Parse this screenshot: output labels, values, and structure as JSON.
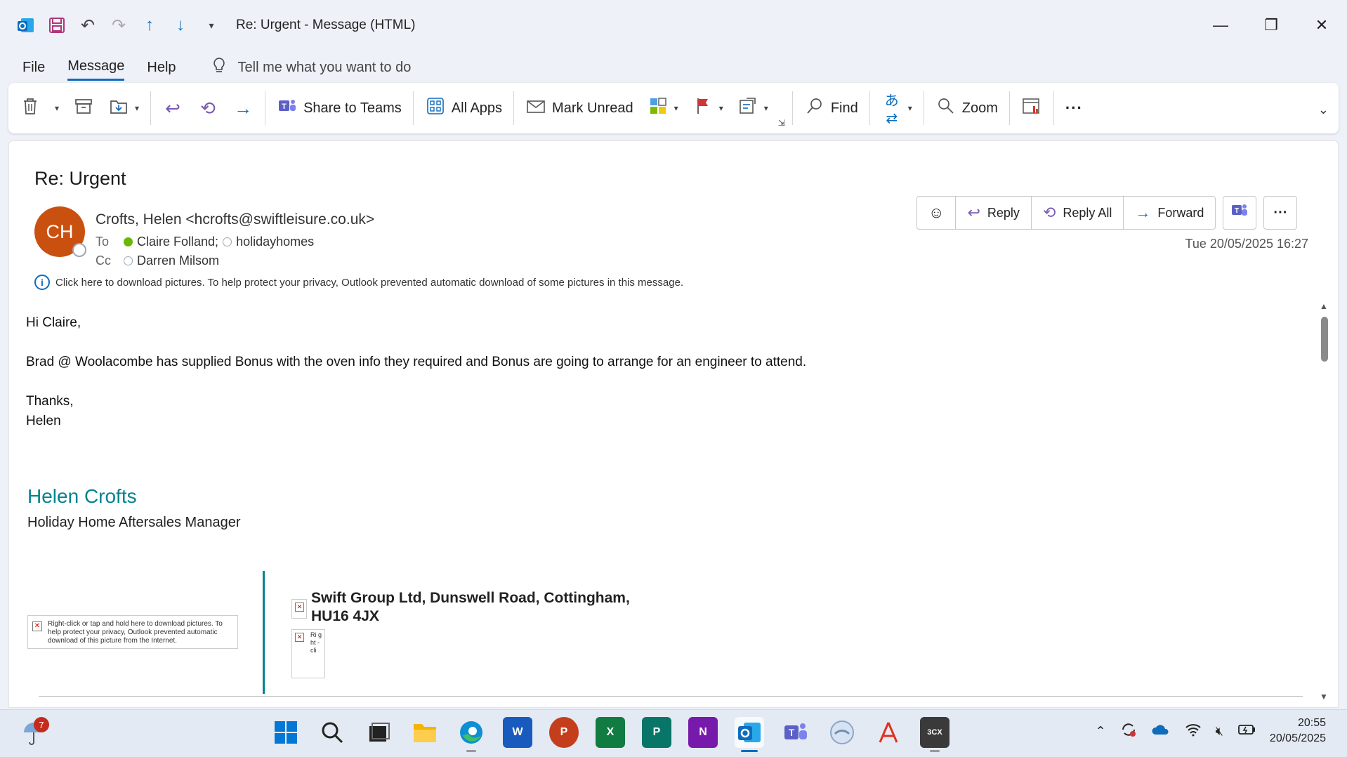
{
  "window": {
    "title": "Re: Urgent  -  Message (HTML)",
    "quick_access_icons": [
      "outlook-icon",
      "save-icon",
      "undo-icon",
      "redo-icon",
      "previous-item-icon",
      "next-item-icon",
      "customize-qat-icon"
    ]
  },
  "menu": {
    "items": [
      "File",
      "Message",
      "Help"
    ],
    "active": "Message",
    "tell_me": "Tell me what you want to do"
  },
  "ribbon": {
    "share_to_teams": "Share to Teams",
    "all_apps": "All Apps",
    "mark_unread": "Mark Unread",
    "find": "Find",
    "zoom": "Zoom",
    "more": "···"
  },
  "message": {
    "subject": "Re: Urgent",
    "avatar_initials": "CH",
    "avatar_color": "#ca5010",
    "from": "Crofts, Helen <hcrofts@swiftleisure.co.uk>",
    "to_label": "To",
    "to": [
      "Claire Folland;",
      "holidayhomes"
    ],
    "cc_label": "Cc",
    "cc": [
      "Darren Milsom"
    ],
    "date": "Tue 20/05/2025 16:27",
    "info_bar": "Click here to download pictures. To help protect your privacy, Outlook prevented automatic download of some pictures in this message.",
    "actions": {
      "reply": "Reply",
      "reply_all": "Reply All",
      "forward": "Forward"
    },
    "body": {
      "greeting": "Hi Claire,",
      "line1": "Brad @ Woolacombe has supplied Bonus with the oven info they required and Bonus are going to arrange for an engineer to attend.",
      "thanks": "Thanks,",
      "name": "Helen"
    },
    "signature": {
      "name": "Helen Crofts",
      "title": "Holiday Home Aftersales Manager",
      "image_placeholder": "Right-click or tap and hold here to download pictures. To help protect your privacy, Outlook prevented automatic download of this picture from the Internet.",
      "address_line1": "Swift Group Ltd, Dunswell Road, Cottingham,",
      "address_line2": "HU16 4JX",
      "small_placeholder": "Ri g ht - cli"
    }
  },
  "taskbar": {
    "notification_count": "7",
    "apps": [
      "start",
      "search",
      "task-view",
      "file-explorer",
      "edge",
      "word",
      "powerpoint",
      "excel",
      "publisher",
      "onenote",
      "outlook",
      "teams",
      "app",
      "acrobat",
      "3cx"
    ],
    "time": "20:55",
    "date": "20/05/2025"
  }
}
